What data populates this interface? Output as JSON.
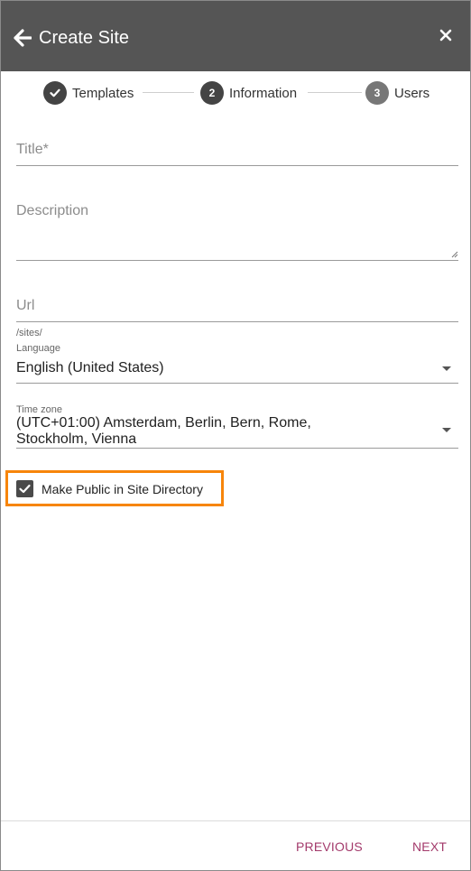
{
  "header": {
    "title": "Create Site",
    "background": "#555555"
  },
  "stepper": {
    "steps": [
      {
        "number": "",
        "label": "Templates",
        "state": "completed"
      },
      {
        "number": "2",
        "label": "Information",
        "state": "active"
      },
      {
        "number": "3",
        "label": "Users",
        "state": "pending"
      }
    ],
    "colors": {
      "completed": "#444444",
      "active": "#444444",
      "pending": "#777777"
    }
  },
  "form": {
    "title": {
      "placeholder": "Title*"
    },
    "description": {
      "placeholder": "Description"
    },
    "url": {
      "placeholder": "Url",
      "hint": "/sites/"
    },
    "language": {
      "label": "Language",
      "value": "English (United States)"
    },
    "timezone": {
      "label": "Time zone",
      "value_line1": "(UTC+01:00) Amsterdam, Berlin, Bern, Rome,",
      "value_line2": "Stockholm, Vienna"
    },
    "make_public": {
      "label": "Make Public in Site Directory",
      "checked": true
    }
  },
  "highlight_color": "#f7850a",
  "footer": {
    "previous_label": "PREVIOUS",
    "next_label": "NEXT",
    "accent": "#a33a6b"
  }
}
